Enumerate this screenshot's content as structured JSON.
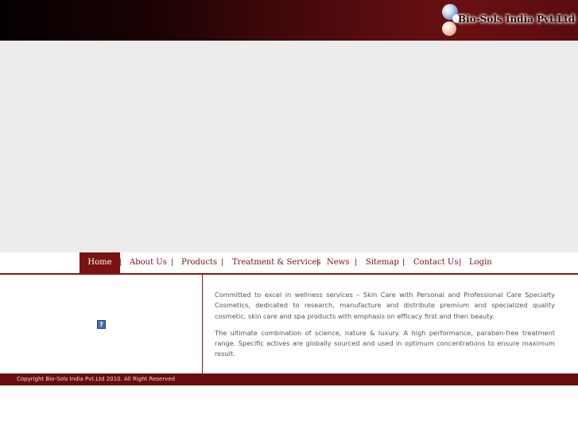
{
  "brand": {
    "name": "Bio-Sols India Pvt.Ltd"
  },
  "nav": {
    "items": [
      {
        "label": "Home",
        "active": true
      },
      {
        "label": "About Us"
      },
      {
        "label": "Products"
      },
      {
        "label": "Treatment & Services"
      },
      {
        "label": "News"
      },
      {
        "label": "Sitemap"
      },
      {
        "label": "Contact Us"
      },
      {
        "label": "Login"
      }
    ],
    "separator": "|"
  },
  "main": {
    "broken_image_glyph": "?",
    "paragraphs": [
      "Committed to excel in wellness services – Skin Care with Personal and Professional Care Specialty Cosmetics, dedicated to research, manufacture and distribute premium and specialized quality cosmetic, skin care and spa products with emphasis on efficacy first and then beauty.",
      "The ultimate combination of science, nature & luxury. A high performance, paraben-free treatment range. Specific actives are globally sourced and used in optimum concentrations to ensure maximum result."
    ]
  },
  "footer": {
    "copyright": "Copyright Bio-Sols India Pvt.Ltd 2010. All Right Reserved"
  },
  "colors": {
    "brand_maroon": "#7a1214",
    "footer_bg": "#6a0c0e",
    "banner_bg": "#ececec"
  }
}
